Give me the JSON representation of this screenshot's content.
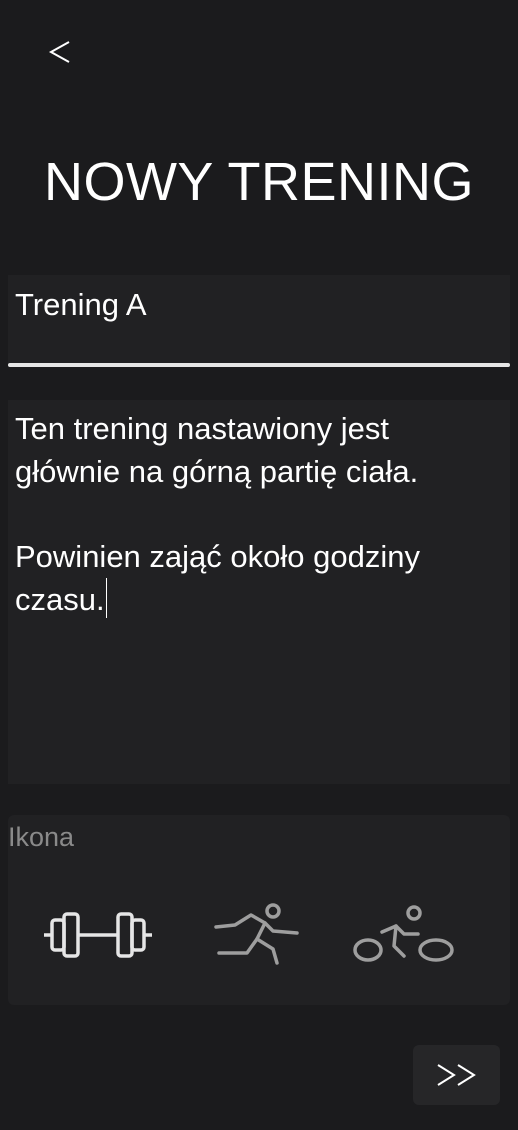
{
  "header": {
    "back_icon": "chevron-left-icon",
    "title": "NOWY TRENING"
  },
  "form": {
    "name_value": "Trening A",
    "description_value": "Ten trening nastawiony jest\ngłównie na górną partię ciała.\n\nPowinien zająć około godziny\nczasu.",
    "icon_label": "Ikona",
    "icons": [
      {
        "name": "dumbbell-icon",
        "selected": true,
        "color": "#e6e6e6"
      },
      {
        "name": "running-icon",
        "selected": false,
        "color": "#9e9e9e"
      },
      {
        "name": "bicycle-icon",
        "selected": false,
        "color": "#9e9e9e"
      }
    ]
  },
  "footer": {
    "next_icon": "double-chevron-right-icon"
  },
  "colors": {
    "background": "#1b1b1d",
    "field_background": "#212123",
    "text": "#ffffff",
    "muted_text": "#8a8a8a"
  }
}
